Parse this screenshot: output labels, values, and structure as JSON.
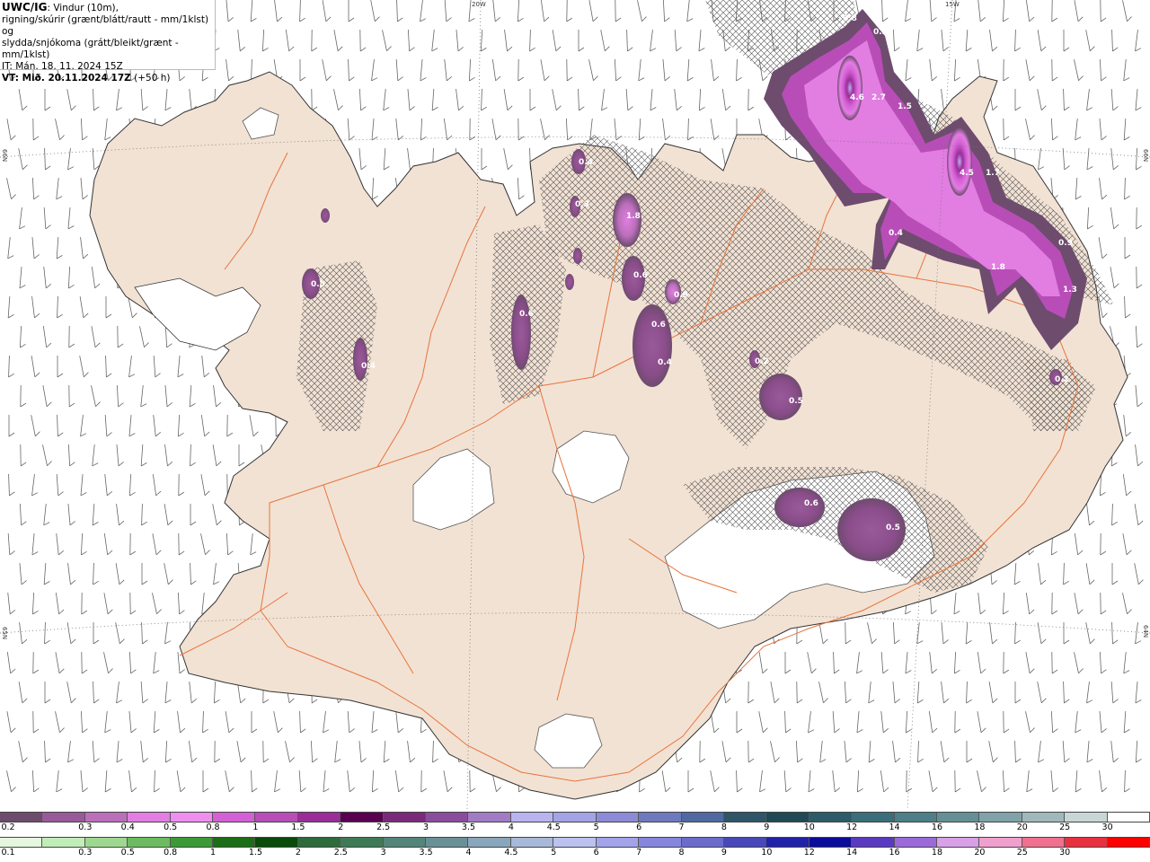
{
  "header": {
    "model": "UWC/IG",
    "title_rest": ": Vindur (10m),",
    "line2": "rigning/skúrir (grænt/blátt/rautt - mm/1klst) og",
    "line3": "slydda/snjókoma (grátt/bleikt/grænt - mm/1klst)",
    "it_label": "IT: Mán. 18. 11. 2024 15Z",
    "vt_label": "VT: Mið. 20.11.2024 17Z",
    "vt_offset": "(+50 h)"
  },
  "grid_labels": {
    "top_20w": "20W",
    "top_15w": "15W",
    "left_66n": "66N",
    "right_66n": "66N",
    "left_65n": "65N",
    "right_64n": "64N"
  },
  "precip_labels": [
    {
      "id": "p1",
      "text": "0.8"
    },
    {
      "id": "p2",
      "text": "0.3"
    },
    {
      "id": "p3",
      "text": "4.6"
    },
    {
      "id": "p4",
      "text": "2.7"
    },
    {
      "id": "p5",
      "text": "1.5"
    },
    {
      "id": "p6",
      "text": "4.5"
    },
    {
      "id": "p7",
      "text": "1.7"
    },
    {
      "id": "p8",
      "text": "0.4"
    },
    {
      "id": "p9",
      "text": "0.9"
    },
    {
      "id": "p10",
      "text": "1.8"
    },
    {
      "id": "p11",
      "text": "1.3"
    },
    {
      "id": "p12",
      "text": "0.4"
    },
    {
      "id": "p13",
      "text": "1.8"
    },
    {
      "id": "p14",
      "text": "0.6"
    },
    {
      "id": "p15",
      "text": "0.9"
    },
    {
      "id": "p16",
      "text": "0.6"
    },
    {
      "id": "p17",
      "text": "0.4"
    },
    {
      "id": "p18",
      "text": "0.6"
    },
    {
      "id": "p19",
      "text": "0.5"
    },
    {
      "id": "p20",
      "text": "0.5"
    },
    {
      "id": "p21",
      "text": "0.6"
    },
    {
      "id": "p22",
      "text": "0.5"
    },
    {
      "id": "p23",
      "text": "0.4"
    },
    {
      "id": "p24",
      "text": "0.2"
    },
    {
      "id": "p25",
      "text": "0.3"
    },
    {
      "id": "p26",
      "text": "0.2"
    }
  ],
  "legend_snow": {
    "labels": [
      "0.2",
      "0.3",
      "0.4",
      "0.5",
      "0.8",
      "1",
      "1.5",
      "2",
      "2.5",
      "3",
      "3.5",
      "4",
      "4.5",
      "5",
      "6",
      "7",
      "8",
      "9",
      "10",
      "12",
      "14",
      "16",
      "18",
      "20",
      "25",
      "30"
    ],
    "colors": [
      "#6e4c6e",
      "#9a5a9a",
      "#bb6fbb",
      "#e27de2",
      "#f08ef0",
      "#d560d5",
      "#b84db8",
      "#9a2d9a",
      "#5a0050",
      "#7a2a7a",
      "#8a4d9e",
      "#a27bc6",
      "#b9b4f0",
      "#a3a3e6",
      "#8b8bd8",
      "#6f79c0",
      "#4f6aa2",
      "#2e5568",
      "#1f4a55",
      "#2c5b6a",
      "#3a6e7a",
      "#4c7f88",
      "#658f96",
      "#7fa3a8",
      "#9fb8bb",
      "#c8d6d6",
      "#ffffff"
    ]
  },
  "legend_rain": {
    "labels": [
      "0.1",
      "0.3",
      "0.5",
      "0.8",
      "1",
      "1.5",
      "2",
      "2.5",
      "3",
      "3.5",
      "4",
      "4.5",
      "5",
      "6",
      "7",
      "8",
      "9",
      "10",
      "12",
      "14",
      "16",
      "18",
      "20",
      "25",
      "30"
    ],
    "colors": [
      "#e6f7e0",
      "#c2ecb8",
      "#9ed890",
      "#6cbb60",
      "#3c9a36",
      "#1c6e16",
      "#0a4a0a",
      "#2d6b3a",
      "#3e7a55",
      "#54857a",
      "#6a9096",
      "#8aa6ba",
      "#a8b8d8",
      "#bcc2ee",
      "#a3a3ea",
      "#8686dc",
      "#6b6bcc",
      "#4848b8",
      "#2222a8",
      "#0c0c9a",
      "#5a3ac0",
      "#9a6ad8",
      "#d8a0e6",
      "#f0a0cc",
      "#f07090",
      "#e83040",
      "#ff0000"
    ]
  }
}
